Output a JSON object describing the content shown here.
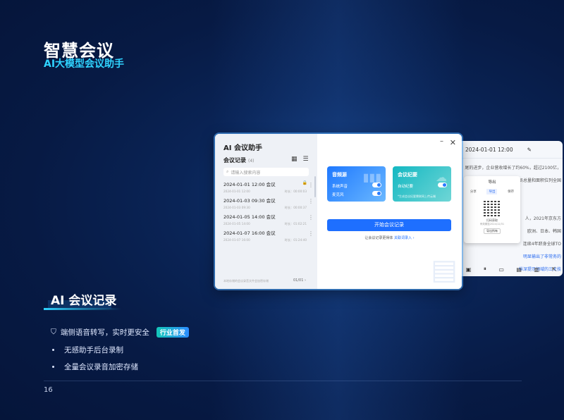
{
  "slide": {
    "title": "智慧会议",
    "subtitle": "AI大模型会议助手",
    "section_title": "AI 会议记录",
    "features": [
      {
        "text": "端侧语音转写，实时更安全",
        "badge": "行业首发"
      },
      {
        "text": "无感助手后台录制"
      },
      {
        "text": "全量会议录音加密存储"
      }
    ],
    "page_number": "16"
  },
  "app": {
    "title": "AI 会议助手",
    "list_title": "会议记录",
    "list_count": "(4)",
    "search_placeholder": "请输入搜索内容",
    "records": [
      {
        "title": "2024-01-01 12:00 会议",
        "time": "2024-01-01 12:00",
        "duration": "时长：00:00:03"
      },
      {
        "title": "2024-01-03 09:30 会议",
        "time": "2024-01-03 09:30",
        "duration": "时长：00:00:37"
      },
      {
        "title": "2024-01-05 14:00 会议",
        "time": "2024-01-05 14:00",
        "duration": "时长：01:02:21"
      },
      {
        "title": "2024-01-07 16:00 会议",
        "time": "2024-01-07 16:00",
        "duration": "时长：01:24:40"
      }
    ],
    "footer_note": "本地存储的会议录音文件会加密存储",
    "pager": "01/01",
    "audio_card": {
      "title": "音频源",
      "row1": "系统声音",
      "row2": "麦克风"
    },
    "summary_card": {
      "title": "会议纪要",
      "row1": "自动纪要",
      "note": "*生成会议纪要需联网上传云端"
    },
    "start_button": "开始会议记录",
    "hint_prefix": "让会议记录更得体",
    "hint_link": "关联词录入",
    "colors": {
      "accent": "#1e6fff",
      "title_cyan": "#2fd3ff",
      "badge": "#14c7b8"
    }
  },
  "back_window": {
    "title": "2024-01-01 12:00",
    "lines": [
      "尾的进步，企业营收增长了约60%，超过2100亿，",
      "员总量和面积位列全国",
      "",
      "",
      "",
      "人，2021年京东方",
      "欧洲、日本、韩国",
      "",
      "连续4年跻身全球TO",
      "",
      "",
      "明显输出了非常务的",
      "纵深提示领域的三大技"
    ],
    "export": {
      "title": "导出",
      "tabs": [
        "分享",
        "导出",
        "保存"
      ],
      "qr_caption": "扫码获取",
      "qr_sub": "有效期至2024/12/31",
      "btn": "导出所有"
    },
    "toolbar": [
      "录音",
      "暂停",
      "笔记",
      "导出",
      "字幕",
      "分享"
    ]
  }
}
